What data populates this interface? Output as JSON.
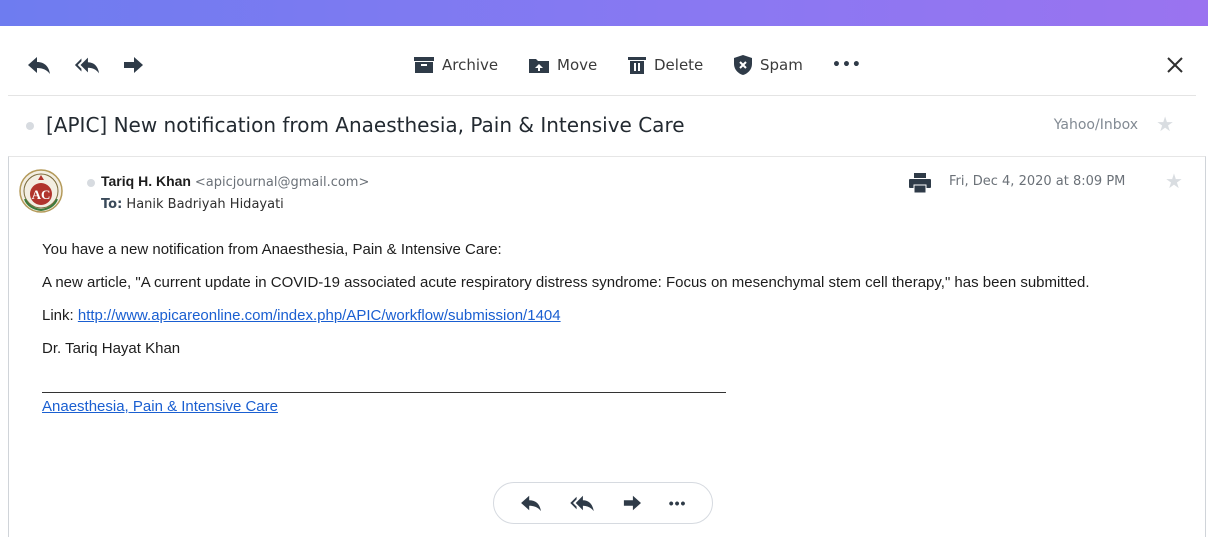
{
  "toolbar": {
    "archive_label": "Archive",
    "move_label": "Move",
    "delete_label": "Delete",
    "spam_label": "Spam",
    "more_label": "•••"
  },
  "subject": {
    "text": "[APIC] New notification from Anaesthesia, Pain & Intensive Care",
    "folder": "Yahoo/Inbox"
  },
  "message": {
    "sender_name": "Tariq H. Khan",
    "sender_email": "<apicjournal@gmail.com>",
    "to_label": "To:",
    "to_name": "Hanik Badriyah Hidayati",
    "date": "Fri, Dec 4, 2020 at 8:09 PM",
    "avatar_text": "AC"
  },
  "body": {
    "line1": "You have a new notification from Anaesthesia, Pain & Intensive Care:",
    "line2": "A new article, \"A current update in COVID-19 associated acute respiratory distress syndrome: Focus on mesenchymal stem cell therapy,\" has been submitted.",
    "link_prefix": "Link: ",
    "link_url": "http://www.apicareonline.com/index.php/APIC/workflow/submission/1404",
    "signature": "Dr. Tariq Hayat Khan",
    "footer_link": "Anaesthesia, Pain & Intensive Care"
  },
  "bottom_actions": {
    "more_label": "•••"
  },
  "colors": {
    "accent_bar": "#7b7af1",
    "link": "#1a5fd1",
    "icon": "#3b3b3b"
  }
}
